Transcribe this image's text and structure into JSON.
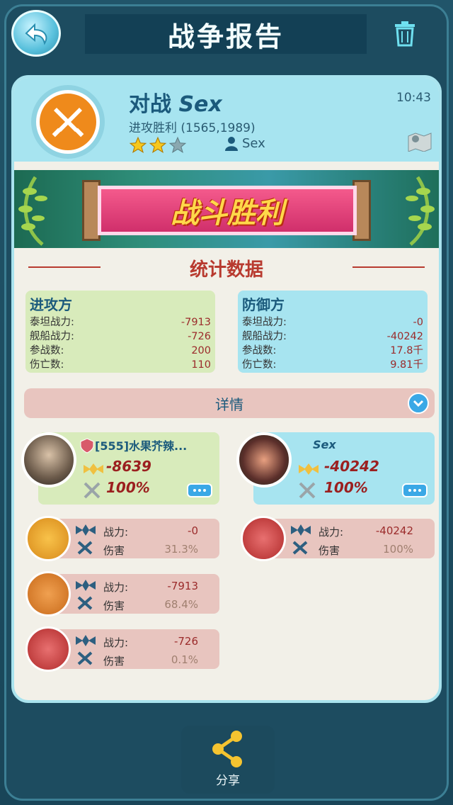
{
  "header": {
    "title": "战争报告",
    "back_icon": "back-arrow-icon",
    "trash_icon": "trash-icon"
  },
  "report": {
    "vs_prefix": "对战",
    "opponent": "Sex",
    "time": "10:43",
    "result": "进攻胜利 (1565,1989)",
    "stars_filled": 2,
    "stars_total": 3,
    "player_name": "Sex"
  },
  "banner": {
    "text": "战斗胜利"
  },
  "stats": {
    "title": "统计数据",
    "attacker": {
      "label": "进攻方",
      "rows": [
        {
          "k": "泰坦战力:",
          "v": "-7913"
        },
        {
          "k": "舰船战力:",
          "v": "-726"
        },
        {
          "k": "参战数:",
          "v": "200"
        },
        {
          "k": "伤亡数:",
          "v": "110"
        }
      ]
    },
    "defender": {
      "label": "防御方",
      "rows": [
        {
          "k": "泰坦战力:",
          "v": "-0"
        },
        {
          "k": "舰船战力:",
          "v": "-40242"
        },
        {
          "k": "参战数:",
          "v": "17.8千"
        },
        {
          "k": "伤亡数:",
          "v": "9.81千"
        }
      ]
    }
  },
  "detail": {
    "label": "详情"
  },
  "att_card": {
    "name": "[555]水果芥辣...",
    "score": "-8639",
    "pct": "100%"
  },
  "def_card": {
    "name": "Sex",
    "score": "-40242",
    "pct": "100%"
  },
  "units_att": [
    {
      "power_label": "战力:",
      "power": "-0",
      "dmg_label": "伤害",
      "dmg": "31.3%"
    },
    {
      "power_label": "战力:",
      "power": "-7913",
      "dmg_label": "伤害",
      "dmg": "68.4%"
    },
    {
      "power_label": "战力:",
      "power": "-726",
      "dmg_label": "伤害",
      "dmg": "0.1%"
    }
  ],
  "units_def": [
    {
      "power_label": "战力:",
      "power": "-40242",
      "dmg_label": "伤害",
      "dmg": "100%"
    }
  ],
  "share": {
    "label": "分享"
  },
  "colors": {
    "accent_blue": "#3aa8e6",
    "attacker_bg": "#d8ebbb",
    "defender_bg": "#a7e4f0",
    "danger": "#9b2b2b"
  }
}
